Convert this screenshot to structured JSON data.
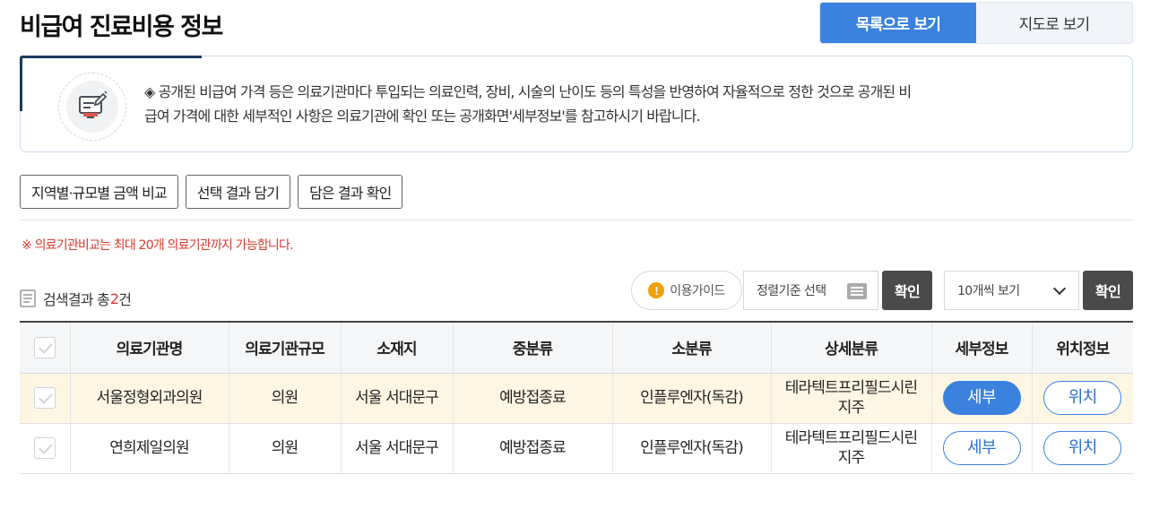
{
  "header": {
    "title": "비급여 진료비용 정보",
    "view_list_label": "목록으로 보기",
    "view_map_label": "지도로 보기"
  },
  "notice": {
    "icon": "monitor-pen-icon",
    "line1": "◈ 공개된 비급여 가격 등은 의료기관마다 투입되는 의료인력, 장비, 시술의 난이도 등의 특성을 반영하여 자율적으로 정한 것으로 공개된 비",
    "line2": "급여 가격에 대한 세부적인 사항은 의료기관에 확인 또는 공개화면'세부정보'를 참고하시기 바랍니다."
  },
  "actions": {
    "compare_label": "지역별·규모별 금액 비교",
    "add_label": "선택 결과 담기",
    "check_label": "담은 결과 확인"
  },
  "compare_note": "※ 의료기관비교는 최대 20개 의료기관까지 가능합니다.",
  "results": {
    "prefix": "검색결과 총",
    "count": "2",
    "suffix": "건"
  },
  "toolbar": {
    "guide_label": "이용가이드",
    "sort_placeholder": "정렬기준 선택",
    "confirm_label": "확인",
    "page_size_label": "10개씩 보기",
    "confirm2_label": "확인"
  },
  "table": {
    "headers": [
      "의료기관명",
      "의료기관규모",
      "소재지",
      "중분류",
      "소분류",
      "상세분류",
      "세부정보",
      "위치정보"
    ],
    "rows": [
      {
        "name": "서울정형외과의원",
        "size": "의원",
        "location": "서울 서대문구",
        "mid": "예방접종료",
        "small": "인플루엔자(독감)",
        "detail_class": "테라텍트프리필드시린지주",
        "detail_btn": "세부",
        "location_btn": "위치"
      },
      {
        "name": "연희제일의원",
        "size": "의원",
        "location": "서울 서대문구",
        "mid": "예방접종료",
        "small": "인플루엔자(독감)",
        "detail_class": "테라텍트프리필드시린지주",
        "detail_btn": "세부",
        "location_btn": "위치"
      }
    ]
  },
  "colors": {
    "accent": "#3b82df",
    "highlight_row": "#fdf6e3",
    "warning_text": "#d9392e",
    "dark_button": "#4a4a4a"
  }
}
